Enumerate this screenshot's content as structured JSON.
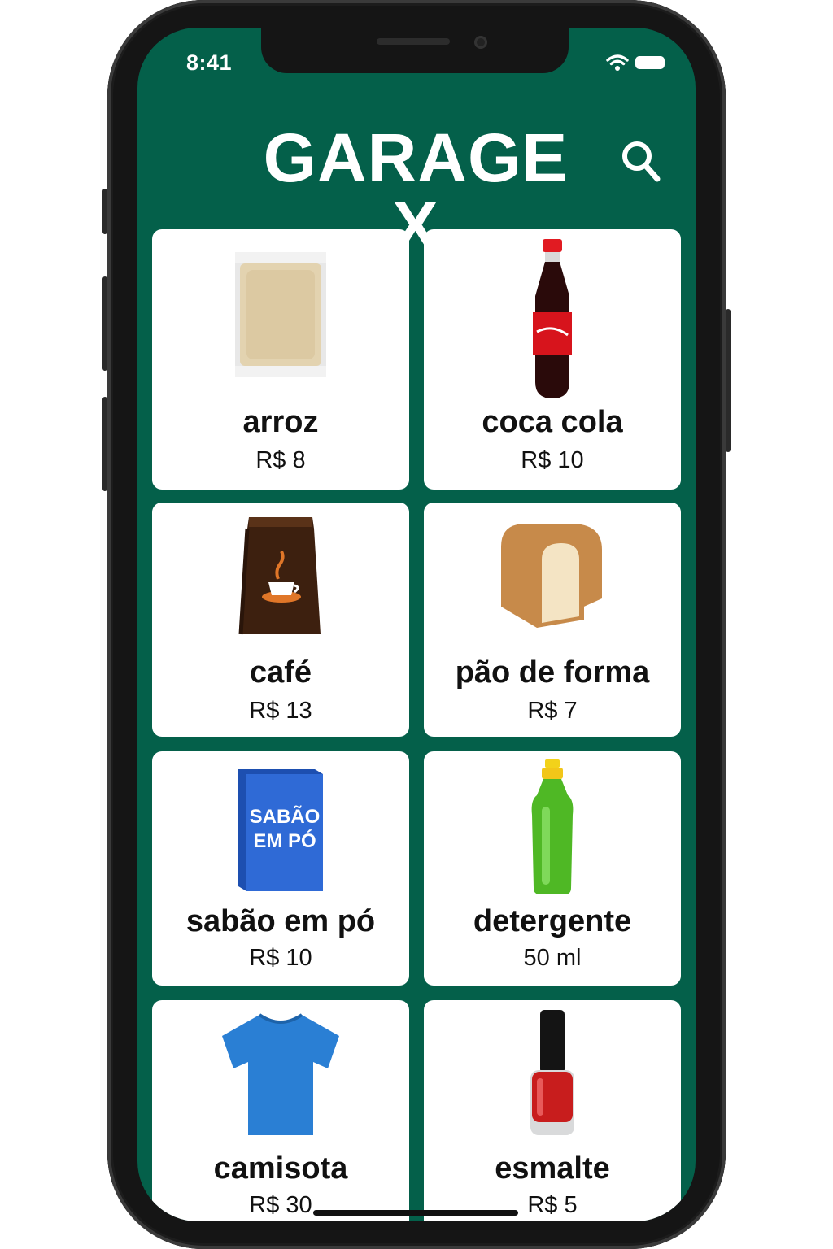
{
  "status_bar": {
    "time": "8:41"
  },
  "header": {
    "title": "GARAGE X"
  },
  "products": [
    {
      "name": "arroz",
      "price": "R$ 8",
      "image": "rice-bag-image"
    },
    {
      "name": "coca cola",
      "price": "R$ 10",
      "image": "cola-bottle-image"
    },
    {
      "name": "café",
      "price": "R$ 13",
      "image": "coffee-bag-image"
    },
    {
      "name": "pão de forma",
      "price": "R$ 7",
      "image": "bread-loaf-image"
    },
    {
      "name": "sabão em pó",
      "price": "R$ 10",
      "image": "detergent-box-image",
      "box_text": "SABÃO EM PÓ"
    },
    {
      "name": "detergente",
      "price": "50 ml",
      "image": "dish-soap-bottle-image"
    },
    {
      "name": "camisota",
      "price": "R$ 30",
      "image": "tshirt-image"
    },
    {
      "name": "esmalte",
      "price": "R$ 5",
      "image": "nail-polish-image"
    }
  ],
  "colors": {
    "background": "#04604a",
    "card": "#ffffff",
    "text": "#111111",
    "header_text": "#ffffff"
  }
}
